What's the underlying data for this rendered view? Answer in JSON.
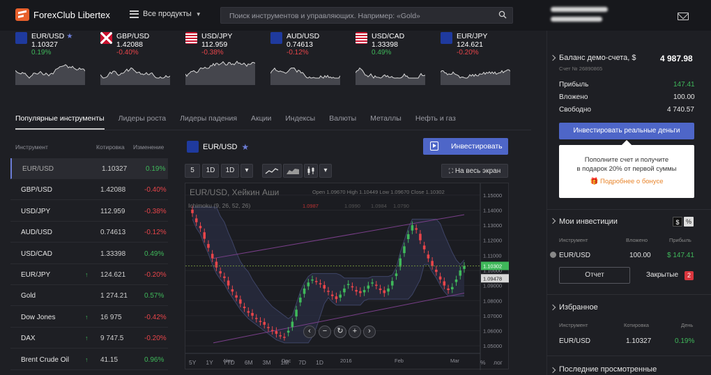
{
  "header": {
    "logo_text": "ForexClub Libertex",
    "menu_label": "Все продукты",
    "search_placeholder": "Поиск инструментов и управляющих. Например: «Gold»"
  },
  "tickers": [
    {
      "symbol": "EUR/USD",
      "price": "1.10327",
      "change": "0.19%",
      "dir": "up",
      "starred": "★",
      "flag": "eu"
    },
    {
      "symbol": "GBP/USD",
      "price": "1.42088",
      "change": "-0.40%",
      "dir": "down",
      "starred": "",
      "flag": "uk"
    },
    {
      "symbol": "USD/JPY",
      "price": "112.959",
      "change": "-0.38%",
      "dir": "down",
      "starred": "",
      "flag": "us"
    },
    {
      "symbol": "AUD/USD",
      "price": "0.74613",
      "change": "-0.12%",
      "dir": "down",
      "starred": "",
      "flag": "au"
    },
    {
      "symbol": "USD/CAD",
      "price": "1.33398",
      "change": "0.49%",
      "dir": "up",
      "starred": "",
      "flag": "us"
    },
    {
      "symbol": "EUR/JPY",
      "price": "124.621",
      "change": "-0.20%",
      "dir": "down",
      "starred": "",
      "flag": "eu"
    }
  ],
  "tabs": [
    "Популярные инструменты",
    "Лидеры роста",
    "Лидеры падения",
    "Акции",
    "Индексы",
    "Валюты",
    "Металлы",
    "Нефть и газ"
  ],
  "list": {
    "headers": {
      "instrument": "Инструмент",
      "quote": "Котировка",
      "change": "Изменение"
    },
    "rows": [
      {
        "name": "EUR/USD",
        "price": "1.10327",
        "change": "0.19%",
        "dir": "up",
        "arrow": ""
      },
      {
        "name": "GBP/USD",
        "price": "1.42088",
        "change": "-0.40%",
        "dir": "down",
        "arrow": ""
      },
      {
        "name": "USD/JPY",
        "price": "112.959",
        "change": "-0.38%",
        "dir": "down",
        "arrow": ""
      },
      {
        "name": "AUD/USD",
        "price": "0.74613",
        "change": "-0.12%",
        "dir": "down",
        "arrow": ""
      },
      {
        "name": "USD/CAD",
        "price": "1.33398",
        "change": "0.49%",
        "dir": "up",
        "arrow": ""
      },
      {
        "name": "EUR/JPY",
        "price": "124.621",
        "change": "-0.20%",
        "dir": "down",
        "arrow": "↑"
      },
      {
        "name": "Gold",
        "price": "1 274.21",
        "change": "0.57%",
        "dir": "up",
        "arrow": ""
      },
      {
        "name": "Dow Jones",
        "price": "16 975",
        "change": "-0.42%",
        "dir": "down",
        "arrow": "↑"
      },
      {
        "name": "DAX",
        "price": "9 747.5",
        "change": "-0.20%",
        "dir": "down",
        "arrow": "↑"
      },
      {
        "name": "Brent Crude Oil",
        "price": "41.15",
        "change": "0.96%",
        "dir": "up",
        "arrow": "↑"
      }
    ]
  },
  "chart_panel": {
    "symbol": "EUR/USD",
    "star": "★",
    "invest_label": "Инвестировать",
    "fullscreen_label": "На весь экран",
    "intervals": [
      "5",
      "1D",
      "1D"
    ],
    "chart_title": "EUR/USD, Хейкин Аши",
    "ohlc_text": "Open 1.09670 High 1.10449 Low 1.09670 Close 1.10302",
    "indicator": "Ichimoku (9, 26, 52, 26)",
    "indicator_vals": [
      "1.0987",
      "1.0990",
      "1.0984",
      "1.0790"
    ],
    "periods": [
      "5Y",
      "1Y",
      "YTD",
      "6M",
      "3M",
      "1M",
      "7D",
      "1D"
    ],
    "pct_label": "%",
    "log_label": "лог"
  },
  "chart_data": {
    "type": "candlestick",
    "title": "EUR/USD, Хейкин Аши",
    "x_ticks": [
      "Nov",
      "Dec",
      "2016",
      "Feb",
      "Mar"
    ],
    "y_ticks": [
      "1.15000",
      "1.14000",
      "1.13000",
      "1.12000",
      "1.11000",
      "1.10000",
      "1.09000",
      "1.08000",
      "1.07000",
      "1.06000",
      "1.05000"
    ],
    "ylim": [
      1.045,
      1.155
    ],
    "last_price": "1.10302",
    "second_price": "1.09478",
    "closes": [
      1.138,
      1.132,
      1.128,
      1.121,
      1.115,
      1.108,
      1.102,
      1.098,
      1.095,
      1.09,
      1.086,
      1.082,
      1.078,
      1.075,
      1.072,
      1.07,
      1.068,
      1.066,
      1.064,
      1.062,
      1.06,
      1.058,
      1.057,
      1.056,
      1.06,
      1.066,
      1.074,
      1.082,
      1.088,
      1.092,
      1.094,
      1.093,
      1.091,
      1.088,
      1.086,
      1.083,
      1.081,
      1.084,
      1.088,
      1.091,
      1.089,
      1.086,
      1.085,
      1.087,
      1.09,
      1.092,
      1.09,
      1.087,
      1.085,
      1.088,
      1.093,
      1.098,
      1.108,
      1.116,
      1.124,
      1.13,
      1.127,
      1.12,
      1.114,
      1.108,
      1.103,
      1.099,
      1.094,
      1.09,
      1.087,
      1.089,
      1.094,
      1.1,
      1.103
    ]
  },
  "sidebar": {
    "balance_label": "Баланс демо-счета, $",
    "balance_value": "4 987.98",
    "account_no": "Счет № 26890865",
    "profit_label": "Прибыль",
    "profit_value": "147.41",
    "invested_label": "Вложено",
    "invested_value": "100.00",
    "free_label": "Свободно",
    "free_value": "4 740.57",
    "real_money_btn": "Инвестировать реальные деньги",
    "promo_line1": "Пополните счет и получите",
    "promo_line2": "в подарок 20% от первой суммы",
    "promo_link": "Подробнее о бонусе",
    "my_inv_title": "Мои инвестиции",
    "toggle_dollar": "$",
    "toggle_pct": "%",
    "inv_headers": {
      "instrument": "Инструмент",
      "invested": "Вложено",
      "profit": "Прибыль"
    },
    "inv_row": {
      "name": "EUR/USD",
      "invested": "100.00",
      "profit": "$ 147.41"
    },
    "report_btn": "Отчет",
    "closed_label": "Закрытые",
    "closed_count": "2",
    "fav_title": "Избранное",
    "fav_headers": {
      "instrument": "Инструмент",
      "quote": "Котировка",
      "day": "День"
    },
    "fav_row": {
      "name": "EUR/USD",
      "quote": "1.10327",
      "day": "0.19%"
    },
    "recent_title": "Последние просмотренные"
  },
  "colors": {
    "up": "#3fb85a",
    "down": "#e8454a",
    "accent": "#4e66c8",
    "bonus": "#e8852c"
  }
}
